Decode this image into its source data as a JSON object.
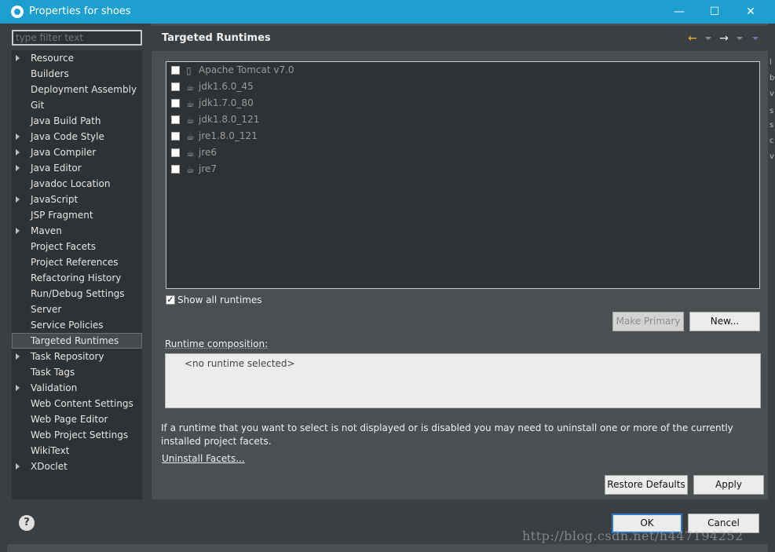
{
  "window": {
    "title": "Properties for shoes",
    "minimize_glyph": "—",
    "maximize_glyph": "☐",
    "close_glyph": "✕"
  },
  "filter": {
    "placeholder": "type filter text"
  },
  "tree": {
    "items": [
      {
        "label": "Resource",
        "expandable": true
      },
      {
        "label": "Builders",
        "expandable": false
      },
      {
        "label": "Deployment Assembly",
        "expandable": false
      },
      {
        "label": "Git",
        "expandable": false
      },
      {
        "label": "Java Build Path",
        "expandable": false
      },
      {
        "label": "Java Code Style",
        "expandable": true
      },
      {
        "label": "Java Compiler",
        "expandable": true
      },
      {
        "label": "Java Editor",
        "expandable": true
      },
      {
        "label": "Javadoc Location",
        "expandable": false
      },
      {
        "label": "JavaScript",
        "expandable": true
      },
      {
        "label": "JSP Fragment",
        "expandable": false
      },
      {
        "label": "Maven",
        "expandable": true
      },
      {
        "label": "Project Facets",
        "expandable": false
      },
      {
        "label": "Project References",
        "expandable": false
      },
      {
        "label": "Refactoring History",
        "expandable": false
      },
      {
        "label": "Run/Debug Settings",
        "expandable": false
      },
      {
        "label": "Server",
        "expandable": false
      },
      {
        "label": "Service Policies",
        "expandable": false
      },
      {
        "label": "Targeted Runtimes",
        "expandable": false,
        "selected": true
      },
      {
        "label": "Task Repository",
        "expandable": true
      },
      {
        "label": "Task Tags",
        "expandable": false
      },
      {
        "label": "Validation",
        "expandable": true
      },
      {
        "label": "Web Content Settings",
        "expandable": false
      },
      {
        "label": "Web Page Editor",
        "expandable": false
      },
      {
        "label": "Web Project Settings",
        "expandable": false
      },
      {
        "label": "WikiText",
        "expandable": false
      },
      {
        "label": "XDoclet",
        "expandable": true
      }
    ]
  },
  "page": {
    "title": "Targeted Runtimes",
    "back_icon": "←",
    "forward_icon": "→"
  },
  "runtimes": [
    {
      "label": "Apache Tomcat v7.0",
      "icon": "server-icon",
      "checked": false
    },
    {
      "label": "jdk1.6.0_45",
      "icon": "jre-icon",
      "checked": false
    },
    {
      "label": "jdk1.7.0_80",
      "icon": "jre-icon",
      "checked": false
    },
    {
      "label": "jdk1.8.0_121",
      "icon": "jre-icon",
      "checked": false
    },
    {
      "label": "jre1.8.0_121",
      "icon": "jre-icon",
      "checked": false
    },
    {
      "label": "jre6",
      "icon": "jre-icon",
      "checked": false
    },
    {
      "label": "jre7",
      "icon": "jre-icon",
      "checked": false
    }
  ],
  "show_all": {
    "label": "Show all runtimes",
    "checked": true,
    "check_glyph": "✓"
  },
  "buttons": {
    "make_primary": "Make Primary",
    "new": "New...",
    "restore_defaults": "Restore Defaults",
    "apply": "Apply",
    "ok": "OK",
    "cancel": "Cancel",
    "help": "?"
  },
  "composition": {
    "label": "Runtime composition:",
    "empty_text": "<no runtime selected>"
  },
  "info_text": "If a runtime that you want to select is not displayed or is disabled you may need to uninstall one or more of the currently installed project facets.",
  "uninstall_link": "Uninstall Facets...",
  "background_strip": [
    "l",
    "b",
    "v",
    "s",
    "s",
    "c",
    "v"
  ],
  "watermark": "http://blog.csdn.net/h447194252",
  "colors": {
    "titlebar": "#1c9ecf",
    "panel": "#3c3f41",
    "content": "#4a4f52",
    "list_bg": "#2f3234"
  }
}
